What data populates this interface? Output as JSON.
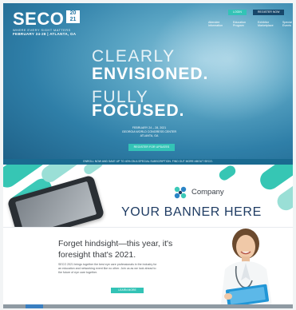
{
  "hero": {
    "logo": "SECO",
    "logo_year_top": "20",
    "logo_year_bottom": "21",
    "logo_sub": "WHERE EVERY SIGHT MATTERS",
    "logo_date": "FEBRUARY 24-28 | ATLANTA, GA",
    "login_label": "LOGIN",
    "register_label": "REGISTER NOW",
    "nav": [
      "Attendee Information",
      "Education Program",
      "Exhibitor Marketplace",
      "Special Events"
    ],
    "headline_1": "CLEARLY",
    "headline_2": "ENVISIONED.",
    "headline_3": "FULLY",
    "headline_4": "FOCUSED.",
    "event_dates": "FEBRUARY 24 – 28, 2021",
    "event_venue": "GEORGIA WORLD CONGRESS CENTER",
    "event_city": "ATLANTA, GA",
    "cta_label": "REGISTER FOR UPDATES",
    "bottom_text": "ENROLL NOW AND SAVE UP TO 40% ON A SPECIAL SUBSCRIPTION. FIND OUT MORE ABOUT SECO."
  },
  "banner": {
    "company": "Company",
    "title": "YOUR BANNER HERE"
  },
  "content": {
    "heading_1": "Forget hindsight—this year, it's",
    "heading_2": "foresight that's 2021.",
    "body": "SECO 2021 brings together the best eye care professionals in the industry for an education and networking event like no other. Join us as we look ahead to the future of eye care together.",
    "button": "LEARN MORE"
  },
  "colors": {
    "accent": "#33c3b6",
    "navy": "#1f3c63",
    "hero": "#2f7fa8"
  }
}
